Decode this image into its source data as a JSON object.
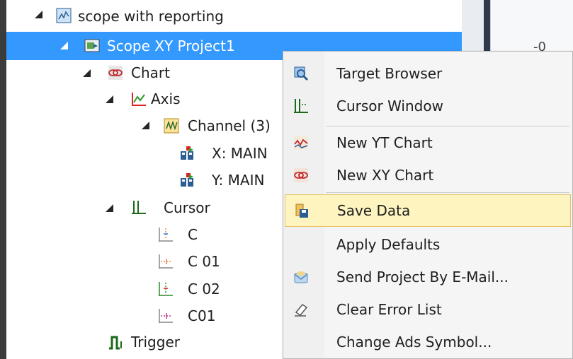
{
  "tree": {
    "root": {
      "label": "scope with reporting",
      "icon": "scope-project-icon"
    },
    "project": {
      "label": "Scope XY Project1",
      "icon": "xy-project-icon"
    },
    "chart": {
      "label": "Chart",
      "icon": "xy-chart-icon"
    },
    "axis": {
      "label": "Axis",
      "icon": "axis-icon"
    },
    "channel": {
      "label": "Channel (3)",
      "icon": "channel-icon"
    },
    "x_acq": {
      "label": "X: MAIN",
      "icon": "acquisition-icon"
    },
    "y_acq": {
      "label": "Y: MAIN",
      "icon": "acquisition-icon"
    },
    "cursor": {
      "label": "Cursor",
      "icon": "cursor-icon"
    },
    "c": {
      "label": "C",
      "icon": "cursor-vertical-icon"
    },
    "c01a": {
      "label": "C 01",
      "icon": "cursor-horizontal-icon"
    },
    "c02": {
      "label": "C 02",
      "icon": "cursor-vertical-green-icon"
    },
    "c01b": {
      "label": "C01",
      "icon": "cursor-horizontal-pink-icon"
    },
    "trigger": {
      "label": "Trigger",
      "icon": "trigger-icon"
    }
  },
  "right_panel": {
    "value": "-0"
  },
  "context_menu": {
    "items": [
      {
        "label": "Target Browser",
        "icon": "target-browser-icon"
      },
      {
        "label": "Cursor Window",
        "icon": "cursor-window-icon"
      },
      {
        "label": "New YT Chart",
        "icon": "yt-chart-icon"
      },
      {
        "label": "New XY Chart",
        "icon": "xy-chart-icon"
      },
      {
        "label": "Save Data",
        "icon": "save-data-icon"
      },
      {
        "label": "Apply Defaults",
        "icon": ""
      },
      {
        "label": "Send Project By E-Mail...",
        "icon": "email-icon"
      },
      {
        "label": "Clear Error List",
        "icon": "eraser-icon"
      },
      {
        "label": "Change Ads Symbol...",
        "icon": ""
      }
    ]
  },
  "colors": {
    "selection": "#3399ff",
    "hover": "#fdf4bf",
    "hover_border": "#e5c365"
  }
}
